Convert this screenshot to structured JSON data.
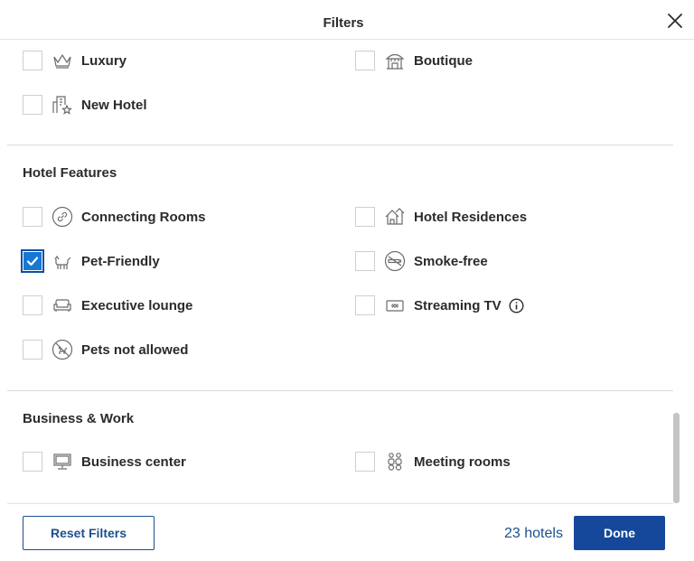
{
  "header": {
    "title": "Filters",
    "close_icon": "close-icon"
  },
  "hotel_types": {
    "items": [
      {
        "label": "Luxury",
        "icon": "crown-icon",
        "checked": false
      },
      {
        "label": "Boutique",
        "icon": "boutique-icon",
        "checked": false
      },
      {
        "label": "New Hotel",
        "icon": "new-hotel-icon",
        "checked": false
      }
    ]
  },
  "hotel_features": {
    "title": "Hotel Features",
    "items": [
      {
        "label": "Connecting Rooms",
        "icon": "link-icon",
        "checked": false
      },
      {
        "label": "Hotel Residences",
        "icon": "residences-icon",
        "checked": false
      },
      {
        "label": "Pet-Friendly",
        "icon": "dog-icon",
        "checked": true
      },
      {
        "label": "Smoke-free",
        "icon": "no-smoking-icon",
        "checked": false
      },
      {
        "label": "Executive lounge",
        "icon": "sofa-icon",
        "checked": false
      },
      {
        "label": "Streaming TV",
        "icon": "tv-icon",
        "checked": false,
        "info_icon": "info-icon"
      },
      {
        "label": "Pets not allowed",
        "icon": "no-pets-icon",
        "checked": false
      }
    ]
  },
  "business_work": {
    "title": "Business & Work",
    "items": [
      {
        "label": "Business center",
        "icon": "computer-icon",
        "checked": false
      },
      {
        "label": "Meeting rooms",
        "icon": "meeting-icon",
        "checked": false
      }
    ]
  },
  "footer": {
    "reset_label": "Reset Filters",
    "count": "23 hotels",
    "done_label": "Done"
  },
  "colors": {
    "accent": "#15489a",
    "checkbox_checked": "#1677d4",
    "text": "#2b2b2b",
    "icon": "#6b6b6b"
  }
}
